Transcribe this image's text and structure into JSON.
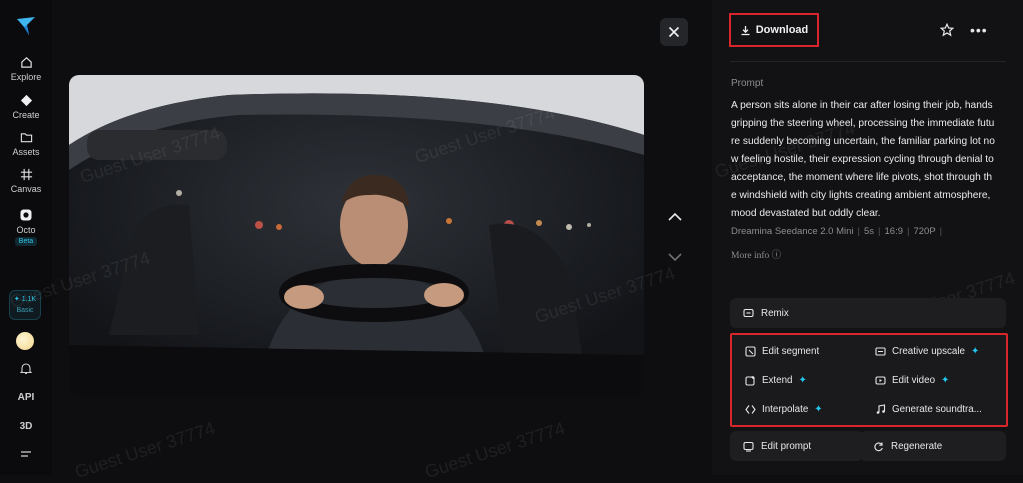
{
  "sidebar": {
    "items": [
      {
        "label": "Explore",
        "icon": "home-icon"
      },
      {
        "label": "Create",
        "icon": "diamond-icon"
      },
      {
        "label": "Assets",
        "icon": "folder-icon"
      },
      {
        "label": "Canvas",
        "icon": "grid-icon"
      },
      {
        "label": "Octo",
        "icon": "octo-icon",
        "badge": "Beta"
      }
    ],
    "credits": {
      "amount": "1.1K",
      "plan": "Basic"
    },
    "bottom": {
      "api": "API",
      "three_d": "3D"
    }
  },
  "viewer": {
    "close_icon": "close-icon",
    "prev_icon": "chevron-up-icon",
    "next_icon": "chevron-down-icon",
    "watermark": "Guest User 37774"
  },
  "panel": {
    "download_label": "Download",
    "prompt_label": "Prompt",
    "prompt_text": "A person sits alone in their car after losing their job, hands gripping the steering wheel, processing the immediate future suddenly becoming uncertain, the familiar parking lot now feeling hostile, their expression cycling through denial to acceptance, the moment where life pivots, shot through the windshield with city lights creating ambient atmosphere, mood devastated but oddly clear.",
    "meta": {
      "model": "Dreamina Seedance 2.0 Mini",
      "duration": "5s",
      "ratio": "16:9",
      "resolution": "720P"
    },
    "more_info": "More info",
    "remix_label": "Remix",
    "grid": {
      "edit_segment": "Edit segment",
      "creative_upscale": "Creative upscale",
      "extend": "Extend",
      "edit_video": "Edit video",
      "interpolate": "Interpolate",
      "generate_soundtrack": "Generate soundtra..."
    },
    "edit_prompt_label": "Edit prompt",
    "regenerate_label": "Regenerate"
  },
  "colors": {
    "accent": "#23c7ef",
    "highlight": "#d8262d"
  }
}
